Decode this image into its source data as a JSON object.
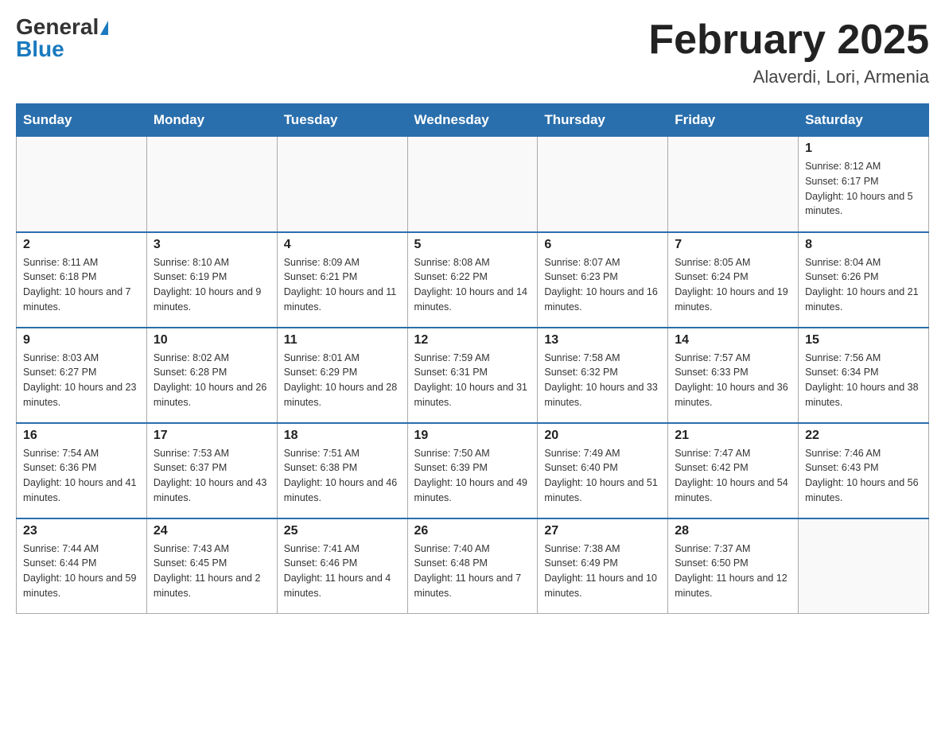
{
  "header": {
    "logo_general": "General",
    "logo_blue": "Blue",
    "month_title": "February 2025",
    "location": "Alaverdi, Lori, Armenia"
  },
  "weekdays": [
    "Sunday",
    "Monday",
    "Tuesday",
    "Wednesday",
    "Thursday",
    "Friday",
    "Saturday"
  ],
  "weeks": [
    [
      {
        "day": "",
        "info": ""
      },
      {
        "day": "",
        "info": ""
      },
      {
        "day": "",
        "info": ""
      },
      {
        "day": "",
        "info": ""
      },
      {
        "day": "",
        "info": ""
      },
      {
        "day": "",
        "info": ""
      },
      {
        "day": "1",
        "info": "Sunrise: 8:12 AM\nSunset: 6:17 PM\nDaylight: 10 hours and 5 minutes."
      }
    ],
    [
      {
        "day": "2",
        "info": "Sunrise: 8:11 AM\nSunset: 6:18 PM\nDaylight: 10 hours and 7 minutes."
      },
      {
        "day": "3",
        "info": "Sunrise: 8:10 AM\nSunset: 6:19 PM\nDaylight: 10 hours and 9 minutes."
      },
      {
        "day": "4",
        "info": "Sunrise: 8:09 AM\nSunset: 6:21 PM\nDaylight: 10 hours and 11 minutes."
      },
      {
        "day": "5",
        "info": "Sunrise: 8:08 AM\nSunset: 6:22 PM\nDaylight: 10 hours and 14 minutes."
      },
      {
        "day": "6",
        "info": "Sunrise: 8:07 AM\nSunset: 6:23 PM\nDaylight: 10 hours and 16 minutes."
      },
      {
        "day": "7",
        "info": "Sunrise: 8:05 AM\nSunset: 6:24 PM\nDaylight: 10 hours and 19 minutes."
      },
      {
        "day": "8",
        "info": "Sunrise: 8:04 AM\nSunset: 6:26 PM\nDaylight: 10 hours and 21 minutes."
      }
    ],
    [
      {
        "day": "9",
        "info": "Sunrise: 8:03 AM\nSunset: 6:27 PM\nDaylight: 10 hours and 23 minutes."
      },
      {
        "day": "10",
        "info": "Sunrise: 8:02 AM\nSunset: 6:28 PM\nDaylight: 10 hours and 26 minutes."
      },
      {
        "day": "11",
        "info": "Sunrise: 8:01 AM\nSunset: 6:29 PM\nDaylight: 10 hours and 28 minutes."
      },
      {
        "day": "12",
        "info": "Sunrise: 7:59 AM\nSunset: 6:31 PM\nDaylight: 10 hours and 31 minutes."
      },
      {
        "day": "13",
        "info": "Sunrise: 7:58 AM\nSunset: 6:32 PM\nDaylight: 10 hours and 33 minutes."
      },
      {
        "day": "14",
        "info": "Sunrise: 7:57 AM\nSunset: 6:33 PM\nDaylight: 10 hours and 36 minutes."
      },
      {
        "day": "15",
        "info": "Sunrise: 7:56 AM\nSunset: 6:34 PM\nDaylight: 10 hours and 38 minutes."
      }
    ],
    [
      {
        "day": "16",
        "info": "Sunrise: 7:54 AM\nSunset: 6:36 PM\nDaylight: 10 hours and 41 minutes."
      },
      {
        "day": "17",
        "info": "Sunrise: 7:53 AM\nSunset: 6:37 PM\nDaylight: 10 hours and 43 minutes."
      },
      {
        "day": "18",
        "info": "Sunrise: 7:51 AM\nSunset: 6:38 PM\nDaylight: 10 hours and 46 minutes."
      },
      {
        "day": "19",
        "info": "Sunrise: 7:50 AM\nSunset: 6:39 PM\nDaylight: 10 hours and 49 minutes."
      },
      {
        "day": "20",
        "info": "Sunrise: 7:49 AM\nSunset: 6:40 PM\nDaylight: 10 hours and 51 minutes."
      },
      {
        "day": "21",
        "info": "Sunrise: 7:47 AM\nSunset: 6:42 PM\nDaylight: 10 hours and 54 minutes."
      },
      {
        "day": "22",
        "info": "Sunrise: 7:46 AM\nSunset: 6:43 PM\nDaylight: 10 hours and 56 minutes."
      }
    ],
    [
      {
        "day": "23",
        "info": "Sunrise: 7:44 AM\nSunset: 6:44 PM\nDaylight: 10 hours and 59 minutes."
      },
      {
        "day": "24",
        "info": "Sunrise: 7:43 AM\nSunset: 6:45 PM\nDaylight: 11 hours and 2 minutes."
      },
      {
        "day": "25",
        "info": "Sunrise: 7:41 AM\nSunset: 6:46 PM\nDaylight: 11 hours and 4 minutes."
      },
      {
        "day": "26",
        "info": "Sunrise: 7:40 AM\nSunset: 6:48 PM\nDaylight: 11 hours and 7 minutes."
      },
      {
        "day": "27",
        "info": "Sunrise: 7:38 AM\nSunset: 6:49 PM\nDaylight: 11 hours and 10 minutes."
      },
      {
        "day": "28",
        "info": "Sunrise: 7:37 AM\nSunset: 6:50 PM\nDaylight: 11 hours and 12 minutes."
      },
      {
        "day": "",
        "info": ""
      }
    ]
  ]
}
